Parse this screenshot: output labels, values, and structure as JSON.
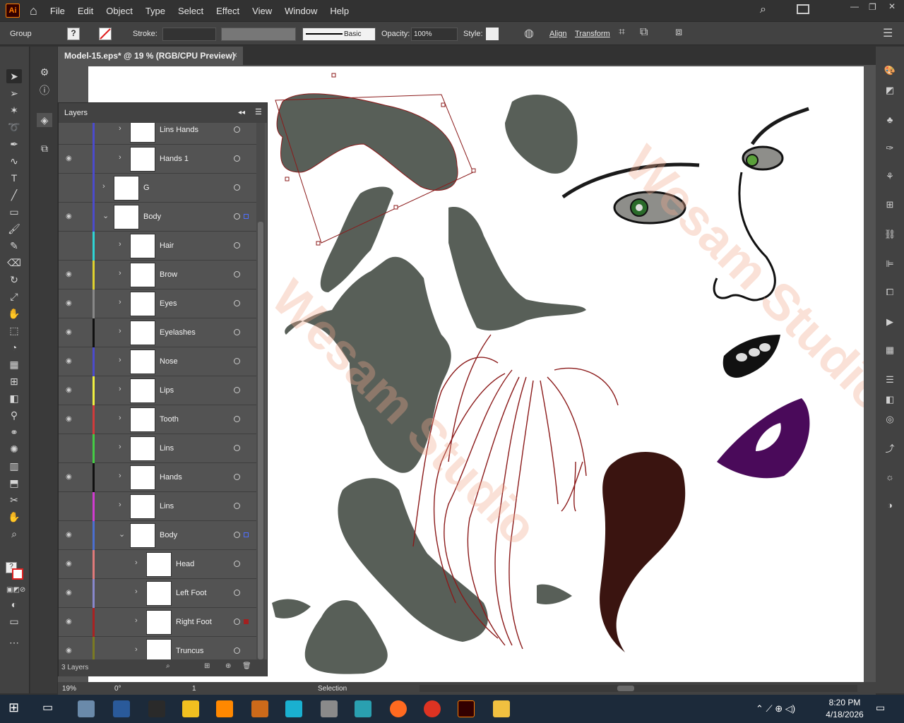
{
  "app": {
    "logo": "Ai",
    "menu": [
      "File",
      "Edit",
      "Object",
      "Type",
      "Select",
      "Effect",
      "View",
      "Window",
      "Help"
    ]
  },
  "control_bar": {
    "selection_type": "Group",
    "stroke_label": "Stroke:",
    "brush": "Basic",
    "opacity_label": "Opacity:",
    "opacity_value": "100%",
    "style_label": "Style:",
    "align": "Align",
    "transform": "Transform"
  },
  "document_tab": {
    "title": "Model-15.eps* @ 19 % (RGB/CPU Preview)",
    "close": "×"
  },
  "layers_panel": {
    "title": "Layers",
    "footer": "3 Layers",
    "rows": [
      {
        "name": "Lins Hands",
        "visible": false,
        "color": "#4b4bcc",
        "indent": 1
      },
      {
        "name": "Hands 1",
        "visible": true,
        "color": "#4b4bcc",
        "indent": 1
      },
      {
        "name": "G",
        "visible": false,
        "color": "#4b4bcc",
        "indent": 0
      },
      {
        "name": "Body",
        "visible": true,
        "color": "#4b4bcc",
        "indent": 0,
        "expanded": true,
        "selected_color": "#4f6fff"
      },
      {
        "name": "Hair",
        "visible": false,
        "color": "#2fd5d5",
        "indent": 1
      },
      {
        "name": "Brow",
        "visible": true,
        "color": "#e0d22e",
        "indent": 1
      },
      {
        "name": "Eyes",
        "visible": true,
        "color": "#888888",
        "indent": 1
      },
      {
        "name": "Eyelashes",
        "visible": true,
        "color": "#111111",
        "indent": 1
      },
      {
        "name": "Nose",
        "visible": true,
        "color": "#4b4bcc",
        "indent": 1
      },
      {
        "name": "Lips",
        "visible": true,
        "color": "#f0f040",
        "indent": 1
      },
      {
        "name": "Tooth",
        "visible": true,
        "color": "#d13b3b",
        "indent": 1
      },
      {
        "name": "Lins",
        "visible": false,
        "color": "#44cc44",
        "indent": 1
      },
      {
        "name": "Hands",
        "visible": true,
        "color": "#111111",
        "indent": 1
      },
      {
        "name": "Lins",
        "visible": false,
        "color": "#d13bd1",
        "indent": 1
      },
      {
        "name": "Body",
        "visible": true,
        "color": "#4b6fd1",
        "indent": 1,
        "expanded": true,
        "selected_color": "#4f6fff"
      },
      {
        "name": "Head",
        "visible": true,
        "color": "#e07a7a",
        "indent": 2
      },
      {
        "name": "Left Foot",
        "visible": true,
        "color": "#8888cc",
        "indent": 2
      },
      {
        "name": "Right Foot",
        "visible": true,
        "color": "#aa2222",
        "indent": 2,
        "selected_color": "#a32020"
      },
      {
        "name": "Truncus",
        "visible": true,
        "color": "#7a7a22",
        "indent": 2
      }
    ]
  },
  "status_bar": {
    "zoom": "19%",
    "rotation": "0°",
    "artboard": "1",
    "tool": "Selection"
  },
  "taskbar": {
    "time": "8:20 PM",
    "date": "4/18/2026"
  },
  "watermark": "Wesam Studio"
}
